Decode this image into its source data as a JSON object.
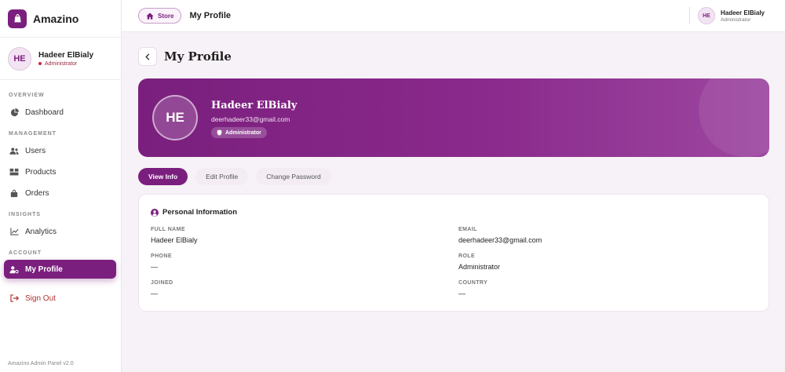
{
  "brand": {
    "name": "Amazino"
  },
  "sidebar": {
    "user": {
      "initials": "HE",
      "name": "Hadeer ElBialy",
      "role": "Administrator"
    },
    "sections": {
      "overview": "OVERVIEW",
      "management": "MANAGEMENT",
      "insights": "INSIGHTS",
      "account": "ACCOUNT"
    },
    "items": {
      "dashboard": "Dashboard",
      "users": "Users",
      "products": "Products",
      "orders": "Orders",
      "analytics": "Analytics",
      "my_profile": "My Profile",
      "sign_out": "Sign Out"
    },
    "footer": "Amazino Admin Panel v2.0"
  },
  "topbar": {
    "store_label": "Store",
    "title": "My Profile",
    "user": {
      "initials": "HE",
      "name": "Hadeer ElBialy",
      "role": "Administrator"
    }
  },
  "page": {
    "title": "My Profile"
  },
  "hero": {
    "initials": "HE",
    "name": "Hadeer ElBialy",
    "email": "deerhadeer33@gmail.com",
    "badge": "Administrator"
  },
  "tabs": {
    "view_info": "View Info",
    "edit_profile": "Edit Profile",
    "change_password": "Change Password"
  },
  "card": {
    "title": "Personal Information",
    "fields": {
      "full_name": {
        "label": "FULL NAME",
        "value": "Hadeer ElBialy"
      },
      "email": {
        "label": "EMAIL",
        "value": "deerhadeer33@gmail.com"
      },
      "phone": {
        "label": "PHONE",
        "value": "—"
      },
      "role": {
        "label": "ROLE",
        "value": "Administrator"
      },
      "joined": {
        "label": "JOINED",
        "value": "—"
      },
      "country": {
        "label": "COUNTRY",
        "value": "—"
      }
    }
  },
  "colors": {
    "accent": "#7b1f7e",
    "signout": "#b0332f"
  }
}
